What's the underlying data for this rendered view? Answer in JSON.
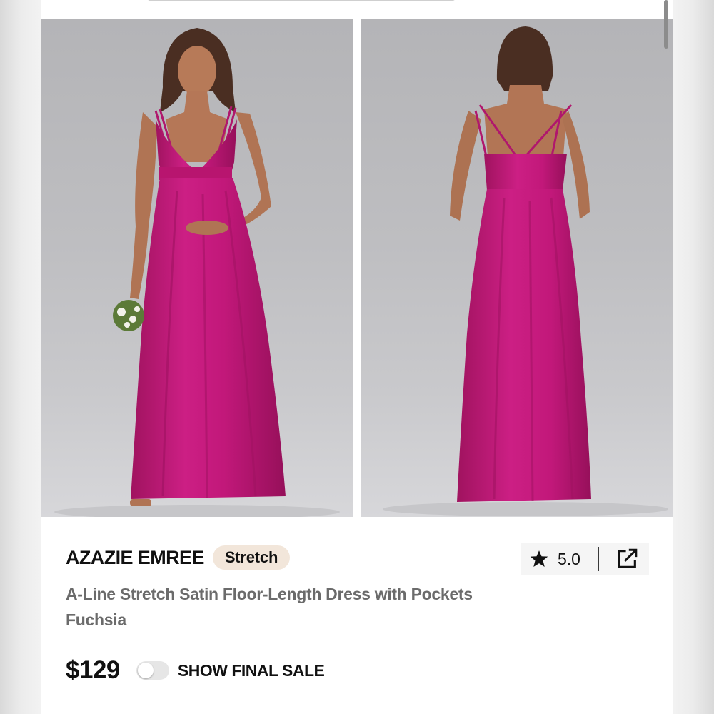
{
  "product": {
    "brand": "AZAZIE EMREE",
    "badge": "Stretch",
    "title_line1": "A-Line Stretch Satin Floor-Length Dress with Pockets",
    "title_line2": "Fuchsia",
    "price": "$129",
    "rating": "5.0",
    "final_sale_label": "SHOW FINAL SALE",
    "final_sale_enabled": false
  },
  "gallery": {
    "images": [
      "front-view",
      "back-view"
    ],
    "dress_color": "#c2187a",
    "background_color": "#bcbcbf"
  },
  "icons": {
    "rating": "star-icon",
    "share": "share-external-icon"
  },
  "colors": {
    "badge_background": "#f2e6da",
    "title_text": "#6b6b6b",
    "primary_text": "#111111"
  }
}
